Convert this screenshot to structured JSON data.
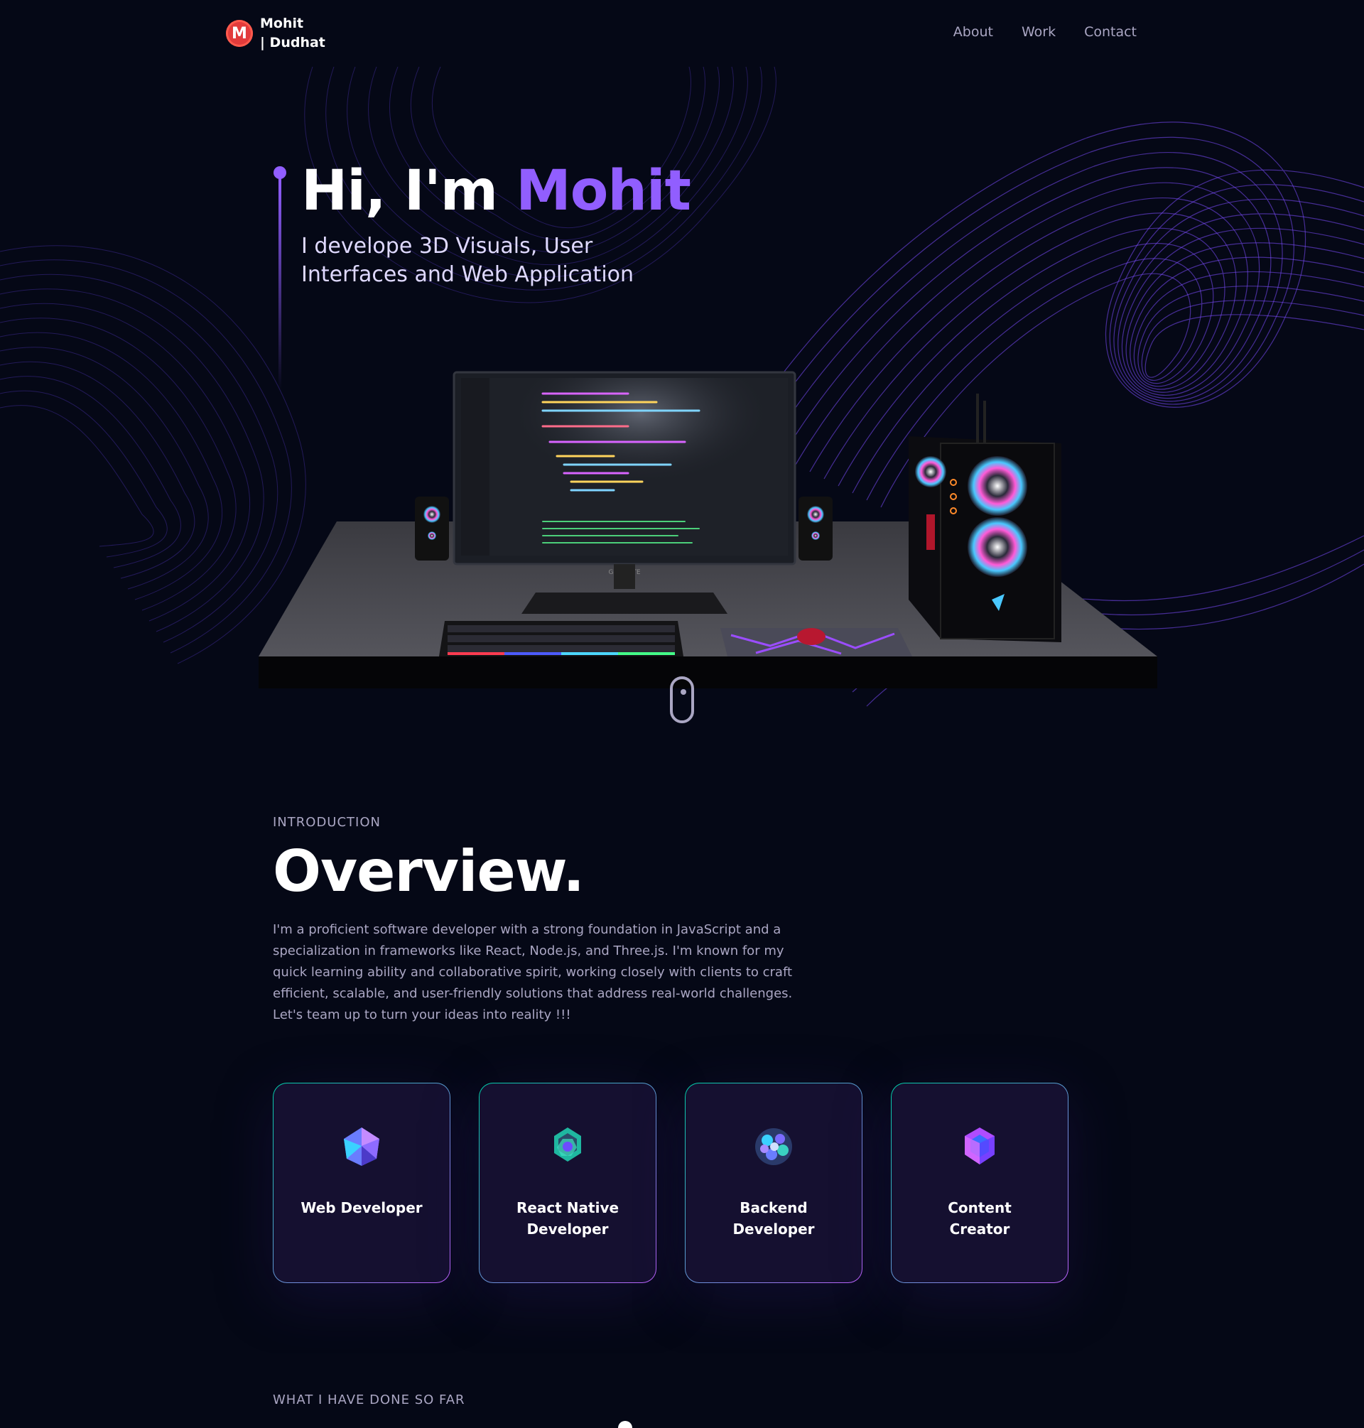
{
  "brand": {
    "logo_letter": "M",
    "name_line1": "Mohit",
    "name_line2": "| Dudhat"
  },
  "nav": {
    "items": [
      {
        "label": "About"
      },
      {
        "label": "Work"
      },
      {
        "label": "Contact"
      }
    ]
  },
  "hero": {
    "title_prefix": "Hi, I'm ",
    "title_highlight": "Mohit",
    "subtitle": "I develope 3D Visuals, User Interfaces and Web Application",
    "monitor_brand": "GIGABYTE"
  },
  "overview": {
    "label": "Introduction",
    "title": "Overview.",
    "text": "I'm a proficient software developer with a strong foundation in JavaScript and a specialization in frameworks like React, Node.js, and Three.js. I'm known for my quick learning ability and collaborative spirit, working closely with clients to craft efficient, scalable, and user-friendly solutions that address real-world challenges. Let's team up to turn your ideas into reality !!!"
  },
  "services": [
    {
      "title": "Web Developer",
      "icon": "web-icon"
    },
    {
      "title": "React Native Developer",
      "icon": "mobile-icon"
    },
    {
      "title": "Backend Developer",
      "icon": "backend-icon"
    },
    {
      "title": "Content Creator",
      "icon": "creator-icon"
    }
  ],
  "work": {
    "label": "What I have done so far"
  },
  "colors": {
    "background": "#050816",
    "accent": "#915eff",
    "secondary_text": "#aaa6c3",
    "card_bg": "#151030",
    "card_gradient_start": "#00cea8",
    "card_gradient_end": "#bf61ff"
  }
}
